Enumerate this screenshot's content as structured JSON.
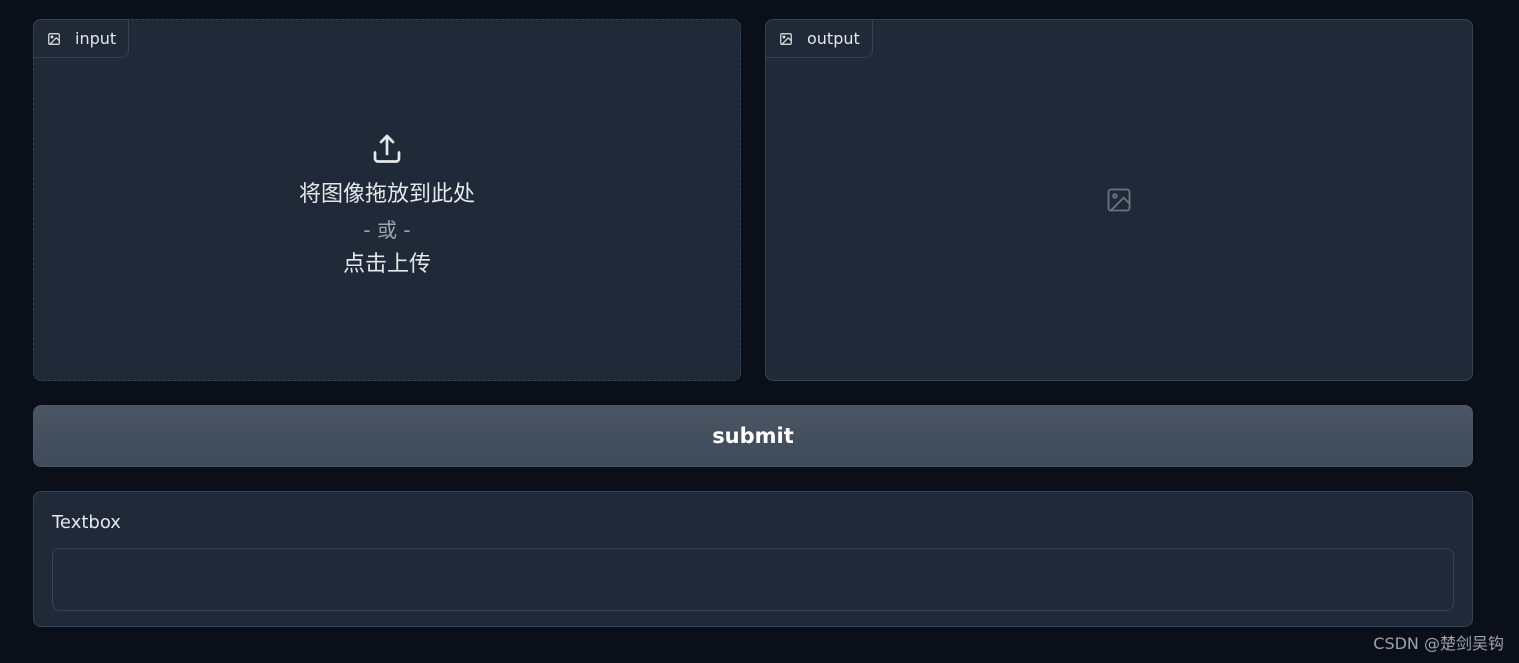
{
  "input": {
    "label": "input",
    "drop_text": "将图像拖放到此处",
    "or_text": "- 或 -",
    "click_text": "点击上传"
  },
  "output": {
    "label": "output"
  },
  "submit": {
    "label": "submit"
  },
  "textbox": {
    "label": "Textbox",
    "value": ""
  },
  "watermark": "CSDN @楚剑吴钩",
  "colors": {
    "background": "#0b0f19",
    "panel": "#1f2937",
    "border": "#374151",
    "button": "#4b5563"
  }
}
